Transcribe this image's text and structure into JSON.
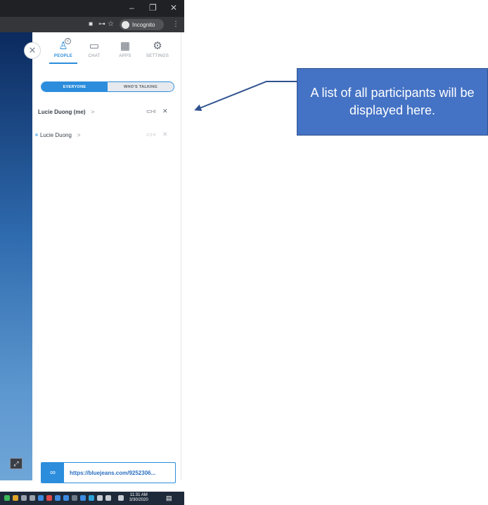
{
  "browser": {
    "minimize_glyph": "–",
    "restore_glyph": "❐",
    "close_glyph": "✕",
    "toolbar_icons": [
      "camera-icon",
      "key-icon",
      "star-icon"
    ],
    "incognito_label": "Incognito",
    "menu_glyph": "⋮"
  },
  "panel": {
    "tabs": [
      {
        "label": "PEOPLE",
        "icon": "people-icon",
        "badge": "2",
        "active": true
      },
      {
        "label": "CHAT",
        "icon": "chat-icon"
      },
      {
        "label": "APPS",
        "icon": "apps-icon"
      },
      {
        "label": "SETTINGS",
        "icon": "settings-icon"
      }
    ],
    "segments": {
      "everyone": "EVERYONE",
      "talking": "WHO'S TALKING",
      "selected": "EVERYONE"
    },
    "participants": [
      {
        "name": "Lucie Duong (me)",
        "chevron": ">",
        "video": "on",
        "mic": "muted"
      },
      {
        "name": "Lucie Duong",
        "chevron": ">",
        "video": "off",
        "mic": "muted"
      }
    ],
    "meeting_url": "https://bluejeans.com/9252306..."
  },
  "taskbar": {
    "time": "11:31 AM",
    "date": "3/30/2020"
  },
  "callout": {
    "text": "A list of all participants will be displayed here.",
    "fill": "#4472c4"
  },
  "colors": {
    "accent": "#2b8ddc",
    "video_strip": "#2e6aae"
  }
}
